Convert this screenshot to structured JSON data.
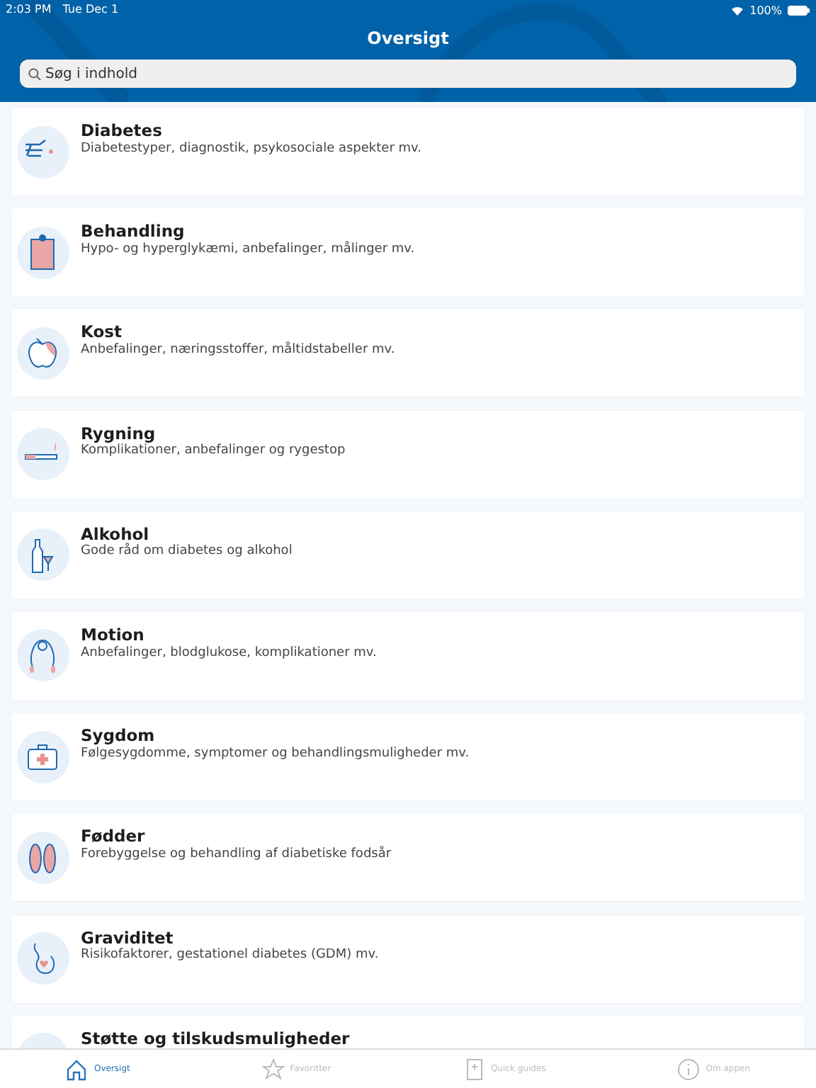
{
  "status_bar": {
    "time": "2:03 PM",
    "date": "Tue Dec 1",
    "battery": "100%"
  },
  "header": {
    "title": "Oversigt"
  },
  "search": {
    "placeholder": "Søg i indhold"
  },
  "topics": [
    {
      "title": "Diabetes",
      "subtitle": "Diabetestyper, diagnostik, psykosociale aspekter mv."
    },
    {
      "title": "Behandling",
      "subtitle": "Hypo- og hyperglykæmi, anbefalinger, målinger mv."
    },
    {
      "title": "Kost",
      "subtitle": "Anbefalinger, næringsstoffer, måltidstabeller mv."
    },
    {
      "title": "Rygning",
      "subtitle": "Komplikationer, anbefalinger og rygestop"
    },
    {
      "title": "Alkohol",
      "subtitle": "Gode råd om diabetes og alkohol"
    },
    {
      "title": "Motion",
      "subtitle": "Anbefalinger, blodglukose, komplikationer mv."
    },
    {
      "title": "Sygdom",
      "subtitle": "Følgesygdomme, symptomer og behandlingsmuligheder mv."
    },
    {
      "title": "Fødder",
      "subtitle": "Forebyggelse og behandling af diabetiske fodsår"
    },
    {
      "title": "Graviditet",
      "subtitle": "Risikofaktorer, gestationel diabetes (GDM) mv."
    },
    {
      "title": "Støtte og tilskudsmuligheder"
    }
  ],
  "tab_bar": [
    {
      "label": "Oversigt",
      "selected": true
    },
    {
      "label": "Favoritter",
      "selected": false
    },
    {
      "label": "Quick guides",
      "selected": false
    },
    {
      "label": "Om appen",
      "selected": false
    }
  ]
}
